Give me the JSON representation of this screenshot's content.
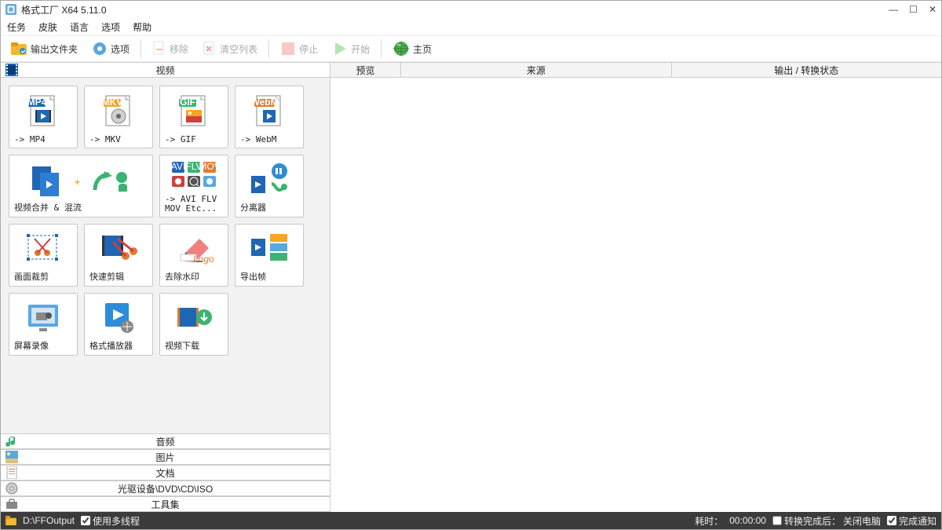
{
  "window": {
    "title": "格式工厂 X64 5.11.0"
  },
  "menu": {
    "task": "任务",
    "skin": "皮肤",
    "lang": "语言",
    "option": "选项",
    "help": "帮助"
  },
  "toolbar": {
    "output_folder": "输出文件夹",
    "options": "选项",
    "remove": "移除",
    "clear": "清空列表",
    "stop": "停止",
    "start": "开始",
    "home": "主页"
  },
  "categories": {
    "video": "视频",
    "audio": "音频",
    "image": "图片",
    "doc": "文档",
    "disc": "光驱设备\\DVD\\CD\\ISO",
    "toolkit": "工具集"
  },
  "cards": {
    "mp4": "-> MP4",
    "mkv": "-> MKV",
    "gif": "-> GIF",
    "webm": "-> WebM",
    "merge": "视频合并 & 混流",
    "avi": "-> AVI FLV MOV Etc...",
    "splitter": "分离器",
    "crop": "画面裁剪",
    "quick": "快速剪辑",
    "watermark": "去除水印",
    "export": "导出帧",
    "record": "屏幕录像",
    "player": "格式播放器",
    "download": "视频下载"
  },
  "right_header": {
    "preview": "预览",
    "source": "来源",
    "status": "输出 / 转换状态"
  },
  "status": {
    "path": "D:\\FFOutput",
    "multithread": "使用多线程",
    "elapsed_label": "耗时：",
    "elapsed": "00:00:00",
    "after_label": "转换完成后：",
    "after_value": "关闭电脑",
    "notify": "完成通知"
  }
}
